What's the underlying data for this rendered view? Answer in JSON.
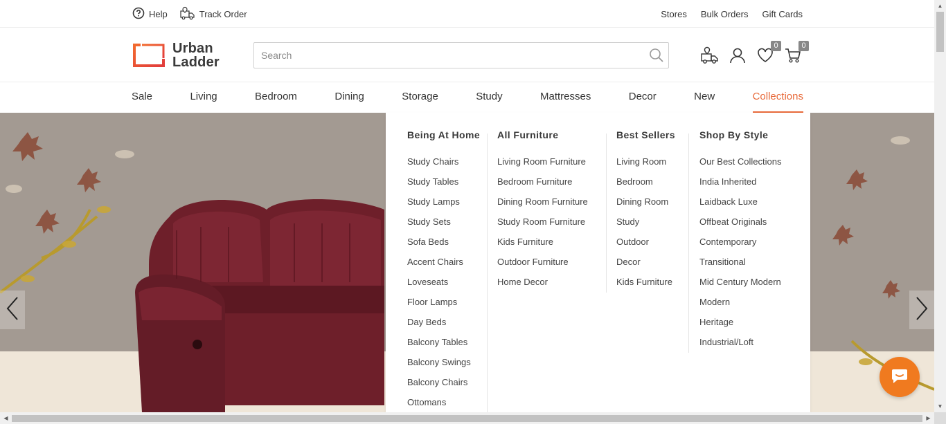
{
  "topbar": {
    "help": "Help",
    "track_order": "Track Order",
    "stores": "Stores",
    "bulk_orders": "Bulk Orders",
    "gift_cards": "Gift Cards"
  },
  "header": {
    "logo_line1": "Urban",
    "logo_line2": "Ladder",
    "search_placeholder": "Search",
    "wishlist_count": "0",
    "cart_count": "0"
  },
  "nav": {
    "items": [
      "Sale",
      "Living",
      "Bedroom",
      "Dining",
      "Storage",
      "Study",
      "Mattresses",
      "Decor",
      "New",
      "Collections"
    ],
    "active": "Collections"
  },
  "mega_menu": {
    "columns": [
      {
        "heading": "Being At Home",
        "links": [
          "Study Chairs",
          "Study Tables",
          "Study Lamps",
          "Study Sets",
          "Sofa Beds",
          "Accent Chairs",
          "Loveseats",
          "Floor Lamps",
          "Day Beds",
          "Balcony Tables",
          "Balcony Swings",
          "Balcony Chairs",
          "Ottomans"
        ]
      },
      {
        "heading": "All Furniture",
        "links": [
          "Living Room Furniture",
          "Bedroom Furniture",
          "Dining Room Furniture",
          "Study Room Furniture",
          "Kids Furniture",
          "Outdoor Furniture",
          "Home Decor"
        ]
      },
      {
        "heading": "Best Sellers",
        "links": [
          "Living Room",
          "Bedroom",
          "Dining Room",
          "Study",
          "Outdoor",
          "Decor",
          "Kids Furniture"
        ]
      },
      {
        "heading": "Shop By Style",
        "links": [
          "Our Best Collections",
          "India Inherited",
          "Laidback Luxe",
          "Offbeat Originals",
          "Contemporary",
          "Transitional",
          "Mid Century Modern",
          "Modern",
          "Heritage",
          "Industrial/Loft"
        ]
      }
    ]
  },
  "colors": {
    "accent": "#e86a3a",
    "chat": "#f07a1f",
    "sofa": "#6e1f2a"
  }
}
